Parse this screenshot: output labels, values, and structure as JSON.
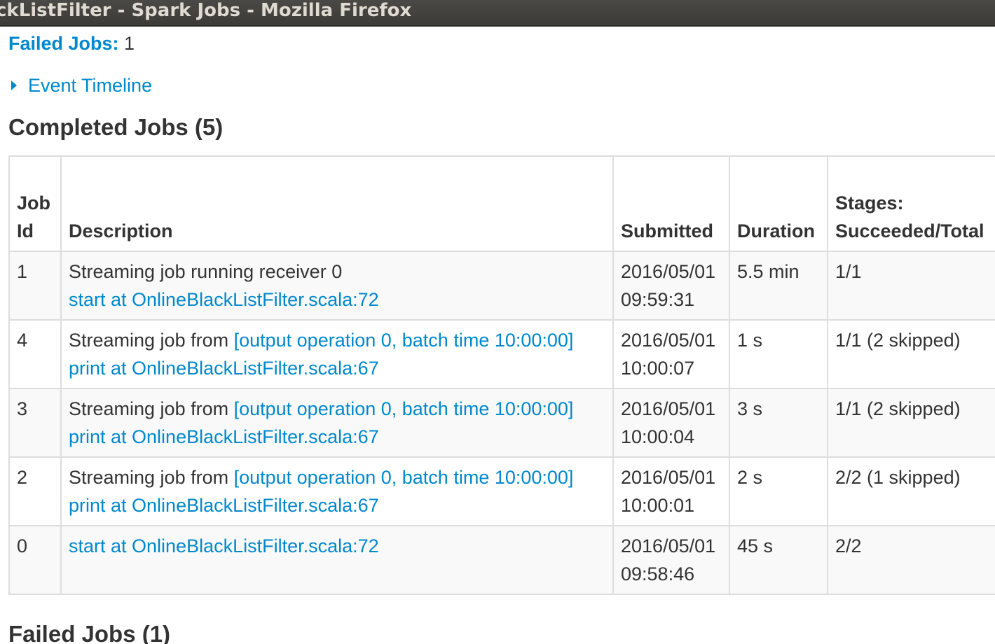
{
  "window": {
    "title": "ckListFilter - Spark Jobs - Mozilla Firefox"
  },
  "summary": {
    "failed_label": "Failed Jobs:",
    "failed_value": "1"
  },
  "timeline": {
    "label": "Event Timeline"
  },
  "completed": {
    "title": "Completed Jobs (5)"
  },
  "failed": {
    "title": "Failed Jobs (1)"
  },
  "table": {
    "headers": {
      "job_id_line1": "Job",
      "job_id_line2": "Id",
      "description": "Description",
      "submitted": "Submitted",
      "duration": "Duration",
      "stages_line1": "Stages:",
      "stages_line2": "Succeeded/Total"
    },
    "rows": [
      {
        "job_id": "1",
        "desc_prefix": "Streaming job running receiver 0",
        "desc_link": "",
        "desc_callsite": "start at OnlineBlackListFilter.scala:72",
        "submitted_date": "2016/05/01",
        "submitted_time": "09:59:31",
        "duration": "5.5 min",
        "stages": "1/1"
      },
      {
        "job_id": "4",
        "desc_prefix": "Streaming job from ",
        "desc_link": "[output operation 0, batch time 10:00:00]",
        "desc_callsite": "print at OnlineBlackListFilter.scala:67",
        "submitted_date": "2016/05/01",
        "submitted_time": "10:00:07",
        "duration": "1 s",
        "stages": "1/1 (2 skipped)"
      },
      {
        "job_id": "3",
        "desc_prefix": "Streaming job from ",
        "desc_link": "[output operation 0, batch time 10:00:00]",
        "desc_callsite": "print at OnlineBlackListFilter.scala:67",
        "submitted_date": "2016/05/01",
        "submitted_time": "10:00:04",
        "duration": "3 s",
        "stages": "1/1 (2 skipped)"
      },
      {
        "job_id": "2",
        "desc_prefix": "Streaming job from ",
        "desc_link": "[output operation 0, batch time 10:00:00]",
        "desc_callsite": "print at OnlineBlackListFilter.scala:67",
        "submitted_date": "2016/05/01",
        "submitted_time": "10:00:01",
        "duration": "2 s",
        "stages": "2/2 (1 skipped)"
      },
      {
        "job_id": "0",
        "desc_prefix": "",
        "desc_link": "",
        "desc_callsite": "start at OnlineBlackListFilter.scala:72",
        "submitted_date": "2016/05/01",
        "submitted_time": "09:58:46",
        "duration": "45 s",
        "stages": "2/2"
      }
    ]
  },
  "colors": {
    "link": "#0088cc",
    "text": "#333333",
    "border": "#dddddd",
    "stripe": "#f9f9f9",
    "titlebar": "#3c3b37",
    "titlebar_text": "#dfdbd2"
  }
}
